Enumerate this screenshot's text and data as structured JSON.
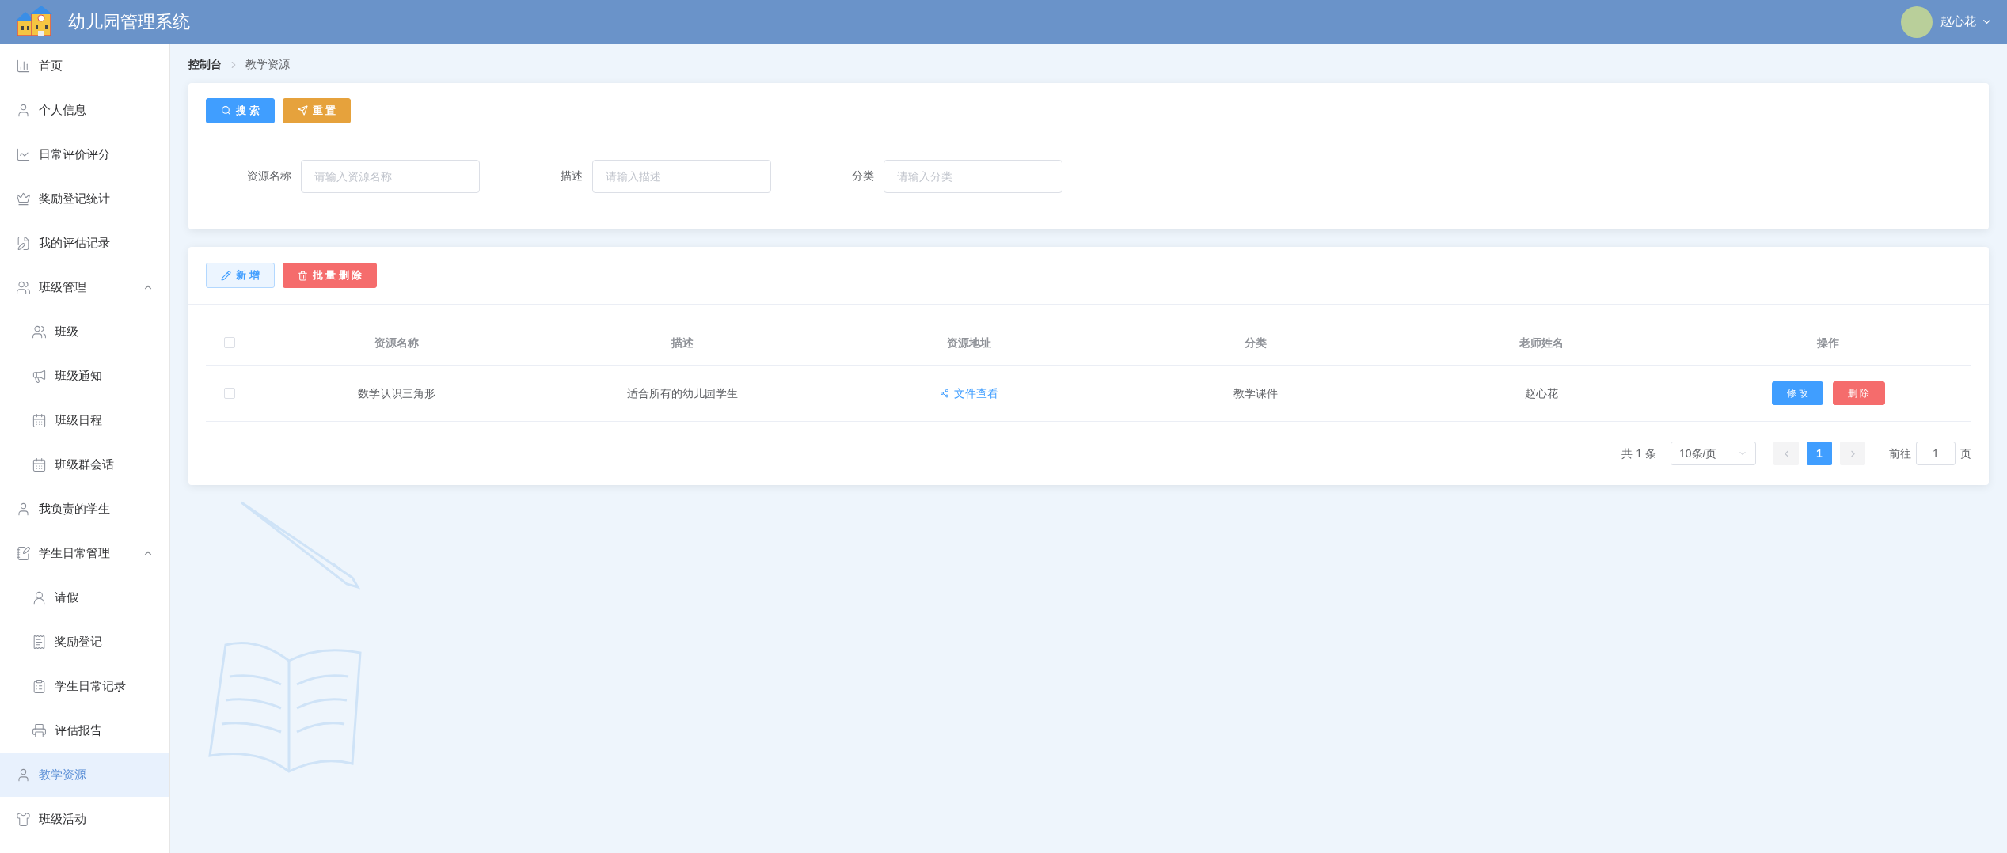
{
  "header": {
    "title": "幼儿园管理系统",
    "user": {
      "name": "赵心花"
    }
  },
  "sidebar": {
    "items": [
      {
        "label": "首页",
        "selected": false
      },
      {
        "label": "个人信息",
        "selected": false
      },
      {
        "label": "日常评价评分",
        "selected": false
      },
      {
        "label": "奖励登记统计",
        "selected": false
      },
      {
        "label": "我的评估记录",
        "selected": false
      },
      {
        "label": "班级管理",
        "selected": false,
        "expanded": true,
        "children": [
          {
            "label": "班级",
            "selected": false
          },
          {
            "label": "班级通知",
            "selected": false
          },
          {
            "label": "班级日程",
            "selected": false
          },
          {
            "label": "班级群会话",
            "selected": false
          }
        ]
      },
      {
        "label": "我负责的学生",
        "selected": false
      },
      {
        "label": "学生日常管理",
        "selected": false,
        "expanded": true,
        "children": [
          {
            "label": "请假",
            "selected": false
          },
          {
            "label": "奖励登记",
            "selected": false
          },
          {
            "label": "学生日常记录",
            "selected": false
          },
          {
            "label": "评估报告",
            "selected": false
          }
        ]
      },
      {
        "label": "教学资源",
        "selected": true
      },
      {
        "label": "班级活动",
        "selected": false
      }
    ]
  },
  "breadcrumb": [
    "控制台",
    "教学资源"
  ],
  "search": {
    "buttons": [
      {
        "label": "搜 索",
        "kind": "search"
      },
      {
        "label": "重 置",
        "kind": "reset"
      }
    ],
    "fields": [
      {
        "label": "资源名称",
        "placeholder": "请输入资源名称"
      },
      {
        "label": "描述",
        "placeholder": "请输入描述"
      },
      {
        "label": "分类",
        "placeholder": "请输入分类"
      }
    ]
  },
  "table": {
    "buttons": [
      {
        "label": "新 增",
        "kind": "add"
      },
      {
        "label": "批 量 删 除",
        "kind": "batch_delete"
      }
    ],
    "all_checked": false,
    "columns": [
      "资源名称",
      "描述",
      "资源地址",
      "分类",
      "老师姓名",
      "操作"
    ],
    "rows": [
      {
        "checked": false,
        "name": "数学认识三角形",
        "description": "适合所有的幼儿园学生",
        "link": "文件查看",
        "category": "教学课件",
        "teacher": "赵心花",
        "actions": [
          {
            "label": "修 改",
            "kind": "edit"
          },
          {
            "label": "删 除",
            "kind": "delete"
          }
        ]
      }
    ]
  },
  "pagination": {
    "total": "共 1 条",
    "page_size": "10条/页",
    "prev_disabled": true,
    "next_disabled": true,
    "pages": [
      {
        "label": "1",
        "selected": true
      }
    ],
    "goto_label": "前往",
    "goto_value": "1",
    "goto_suffix": "页"
  }
}
